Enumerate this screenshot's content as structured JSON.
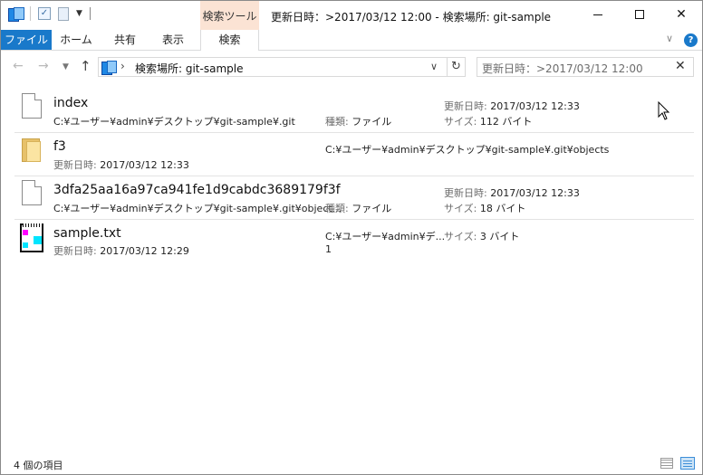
{
  "window": {
    "title": "更新日時：>2017/03/12 12:00 - 検索場所: git-sample",
    "context_tab_header": "検索ツール"
  },
  "ribbon": {
    "tabs": [
      "ファイル",
      "ホーム",
      "共有",
      "表示",
      "検索"
    ],
    "help": "?"
  },
  "nav": {
    "address": "検索場所: git-sample",
    "search_value": "更新日時：>2017/03/12 12:00"
  },
  "items": [
    {
      "name": "index",
      "icon": "file-icon",
      "path": "C:¥ユーザー¥admin¥デスクトップ¥git-sample¥.git",
      "type_label": "種類:",
      "type_value": "ファイル",
      "modified_label": "更新日時:",
      "modified_value": "2017/03/12 12:33",
      "size_label": "サイズ:",
      "size_value": "112 バイト"
    },
    {
      "name": "f3",
      "icon": "folder-icon",
      "path": "C:¥ユーザー¥admin¥デスクトップ¥git-sample¥.git¥objects",
      "modified_label": "更新日時:",
      "modified_value": "2017/03/12 12:33"
    },
    {
      "name": "3dfa25aa16a97ca941fe1d9cabdc3689179f3f",
      "icon": "file-icon",
      "path": "C:¥ユーザー¥admin¥デスクトップ¥git-sample¥.git¥object...",
      "type_label": "種類:",
      "type_value": "ファイル",
      "modified_label": "更新日時:",
      "modified_value": "2017/03/12 12:33",
      "size_label": "サイズ:",
      "size_value": "18 バイト"
    },
    {
      "name": "sample.txt",
      "icon": "notepad-icon",
      "path": "C:¥ユーザー¥admin¥デ...",
      "snippet": "1",
      "modified_label": "更新日時:",
      "modified_value": "2017/03/12 12:29",
      "size_label": "サイズ:",
      "size_value": "3 バイト"
    }
  ],
  "status": {
    "count": "4 個の項目"
  }
}
